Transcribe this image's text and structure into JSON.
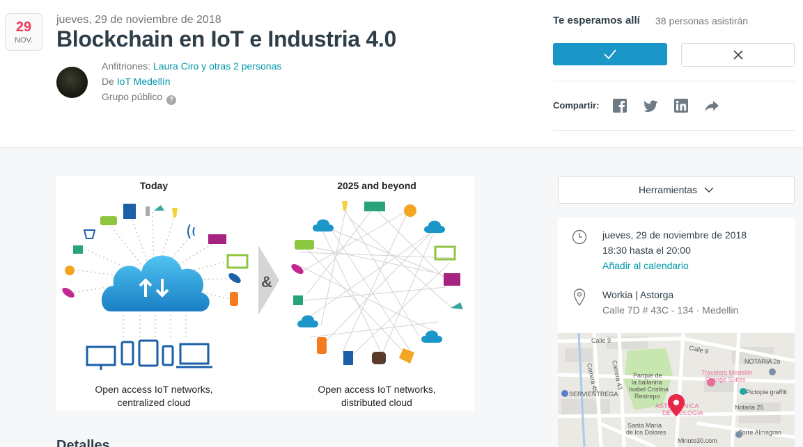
{
  "date_badge": {
    "day": "29",
    "month": "NOV."
  },
  "event": {
    "date": "jueves, 29 de noviembre de 2018",
    "title": "Blockchain en IoT e Industria 4.0",
    "hosts_label": "Anfitriones: ",
    "hosts_link": "Laura Ciro y otras 2 personas",
    "from_label": "De ",
    "group_link": "IoT Medellín",
    "group_type": "Grupo público",
    "help_glyph": "?"
  },
  "rsvp": {
    "title": "Te esperamos allí",
    "count": "38 personas asistirán"
  },
  "share": {
    "label": "Compartir:",
    "icons": [
      "facebook-icon",
      "twitter-icon",
      "linkedin-icon",
      "share-arrow-icon"
    ]
  },
  "hero": {
    "left_title": "Today",
    "right_title": "2025 and beyond",
    "left_caption_1": "Open access IoT networks,",
    "left_caption_2": "centralized cloud",
    "right_caption_1": "Open access IoT networks,",
    "right_caption_2": "distributed cloud",
    "ampersand": "&"
  },
  "tools": {
    "label": "Herramientas"
  },
  "when": {
    "date": "jueves, 29 de noviembre de 2018",
    "time": "18:30 hasta el 20:00",
    "add_calendar": "Añadir al calendario"
  },
  "where": {
    "venue": "Workia | Astorga",
    "address": "Calle 7D # 43C - 134 · Medellin"
  },
  "map": {
    "labels": {
      "calle9a": "Calle 9",
      "calle9b": "Calle 9",
      "notaria2a": "NOTARIA 2a",
      "carrera45": "Carrera 45",
      "carrera43": "Carrera 43",
      "travelers1": "Travelers Medellin",
      "travelers2": "Orange Suites",
      "parque1": "Parque de",
      "parque2": "la bailarina",
      "parque3": "Isabel Cristina",
      "parque4": "Restrepo",
      "servientrega": "SERVIENTREGA",
      "pictopia": "Pictopia graffiti",
      "notaria25": "Notaria 25",
      "clinica1": "ASTO  CLÍNICA",
      "clinica2": "DE  ICOLOGÍA",
      "santa1": "Santa María",
      "santa2": "de los Dolores",
      "torre": "Torre Almagran",
      "minuto": "Minuto30.com"
    }
  },
  "details": {
    "title": "Detalles"
  },
  "colors": {
    "accent": "#1a96c9",
    "link": "#0098ab",
    "date_red": "#f13a59",
    "pin": "#e8294a"
  }
}
